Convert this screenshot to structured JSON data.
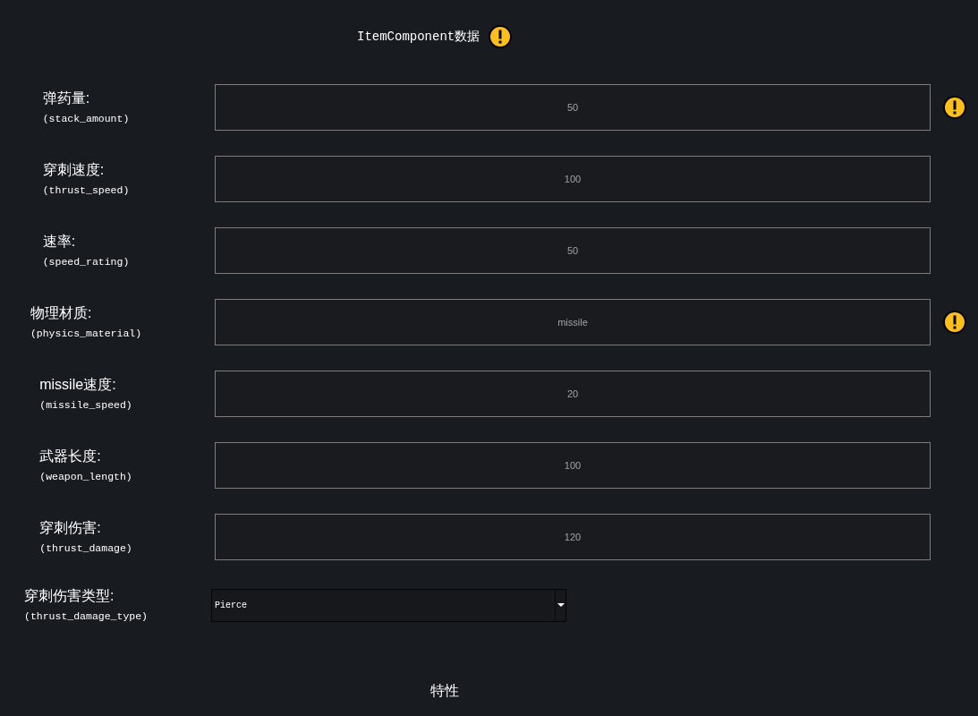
{
  "header": {
    "title": "ItemComponent数据",
    "warning": true
  },
  "fields": [
    {
      "kind": "text",
      "label": "弹药量:",
      "key": "(stack_amount)",
      "value": "50",
      "warning": true
    },
    {
      "kind": "text",
      "label": "穿刺速度:",
      "key": "(thrust_speed)",
      "value": "100",
      "warning": false
    },
    {
      "kind": "text",
      "label": "速率:",
      "key": "(speed_rating)",
      "value": "50",
      "warning": false
    },
    {
      "kind": "text",
      "label": "物理材质:",
      "key": "(physics_material)",
      "value": "missile",
      "warning": true
    },
    {
      "kind": "text",
      "label": "missile速度:",
      "key": "(missile_speed)",
      "value": "20",
      "warning": false
    },
    {
      "kind": "text",
      "label": "武器长度:",
      "key": "(weapon_length)",
      "value": "100",
      "warning": false
    },
    {
      "kind": "text",
      "label": "穿刺伤害:",
      "key": "(thrust_damage)",
      "value": "120",
      "warning": false
    },
    {
      "kind": "dropdown",
      "label": "穿刺伤害类型:",
      "key": "(thrust_damage_type)",
      "value": "Pierce",
      "warning": false
    }
  ],
  "section": {
    "title": "特性"
  }
}
